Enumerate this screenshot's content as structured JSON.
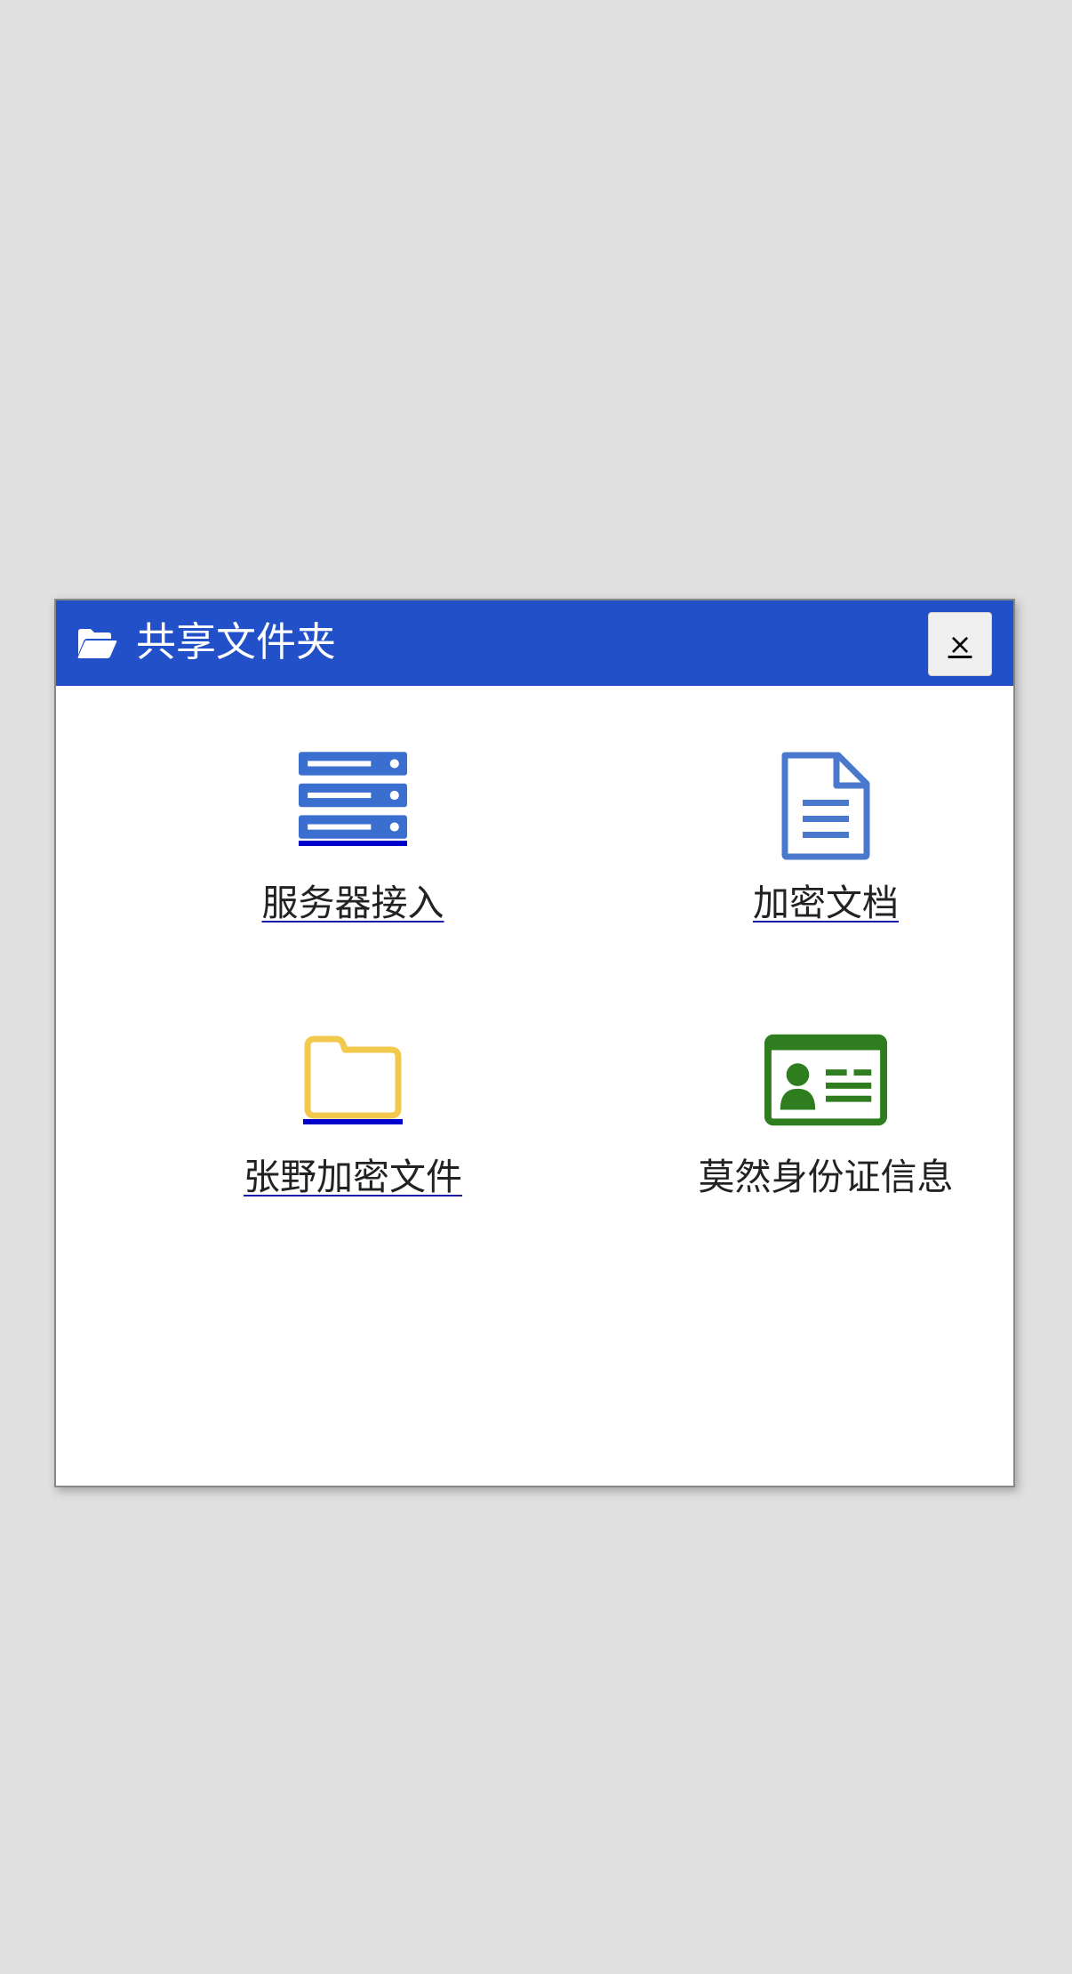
{
  "dialog": {
    "title": "共享文件夹",
    "title_icon": "folder-open-icon",
    "close_label": "×"
  },
  "items": [
    {
      "label": "服务器接入",
      "icon": "server-icon",
      "color": "#3a6fd0",
      "linked": true
    },
    {
      "label": "加密文档",
      "icon": "document-icon",
      "color": "#4a78cc",
      "linked": true
    },
    {
      "label": "张野加密文件",
      "icon": "folder-icon",
      "color": "#f2c94c",
      "linked": true
    },
    {
      "label": "莫然身份证信息",
      "icon": "id-card-icon",
      "color": "#2e7d1e",
      "linked": false
    }
  ],
  "colors": {
    "titlebar": "#2150c8",
    "background": "#e0e0e0",
    "link_underline": "#0000cc"
  }
}
